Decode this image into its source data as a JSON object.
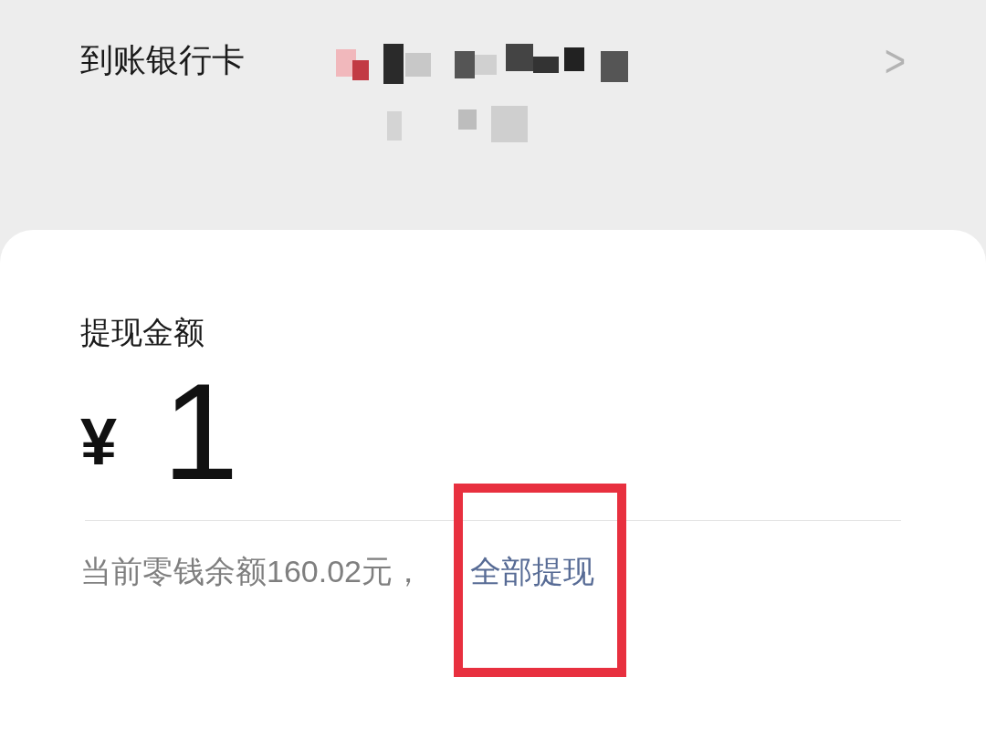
{
  "bank_card": {
    "label": "到账银行卡",
    "chevron": ">"
  },
  "withdraw": {
    "label": "提现金额",
    "currency": "¥",
    "amount": "1"
  },
  "balance": {
    "text": "当前零钱余额160.02元，",
    "link": "全部提现"
  }
}
